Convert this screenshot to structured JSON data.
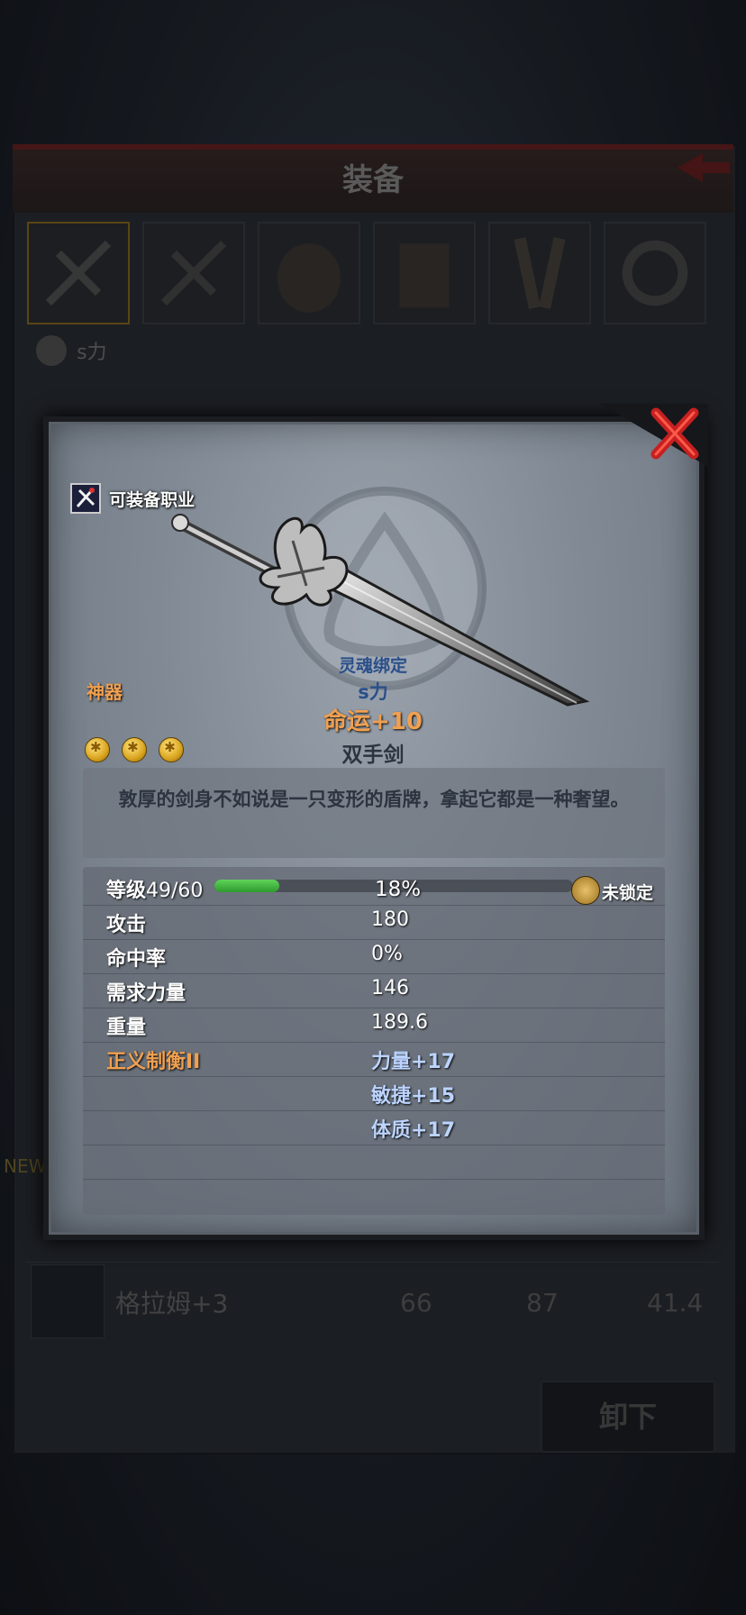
{
  "background": {
    "title": "装备",
    "item_name": "s力",
    "row": {
      "name": "格拉姆+3",
      "values": [
        "66",
        "87",
        "41.4"
      ]
    },
    "unequip_label": "卸下",
    "new_label": "NEW"
  },
  "popup": {
    "job_label": "可装备职业",
    "rarity": "神器",
    "bind": "灵魂绑定",
    "item_name": "s力",
    "fate": "命运+10",
    "weapon_type": "双手剑",
    "gems": 3,
    "description": "敦厚的剑身不如说是一只变形的盾牌，拿起它都是一种奢望。",
    "level": {
      "label": "等级",
      "value": "49/60",
      "percent_text": "18%",
      "progress": 0.18,
      "lock_label": "未锁定"
    },
    "stats": [
      {
        "name": "攻击",
        "value": "180"
      },
      {
        "name": "命中率",
        "value": "0%"
      },
      {
        "name": "需求力量",
        "value": "146"
      },
      {
        "name": "重量",
        "value": "189.6"
      }
    ],
    "set_bonus": {
      "name": "正义制衡II",
      "effects": [
        "力量+17",
        "敏捷+15",
        "体质+17"
      ]
    }
  },
  "colors": {
    "rarity_orange": "#f0a050",
    "bind_blue": "#2a4f8a",
    "progress_green": "#3fb83f",
    "close_red": "#c62020"
  }
}
